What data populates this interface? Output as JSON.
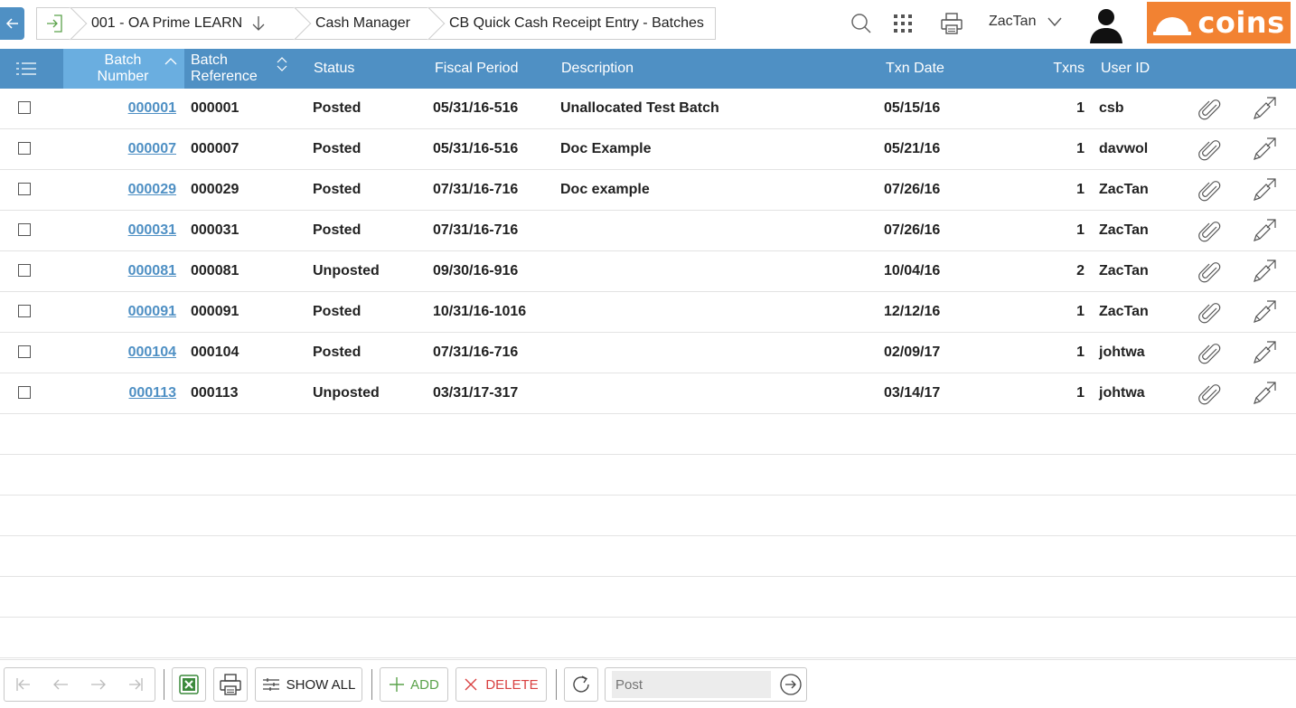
{
  "breadcrumb": {
    "company": "001 - OA Prime LEARN",
    "module": "Cash Manager",
    "page": "CB Quick Cash Receipt Entry - Batches"
  },
  "user": {
    "name": "ZacTan"
  },
  "logo": {
    "text": "coins"
  },
  "colors": {
    "header": "#4f90c4",
    "sorted_header": "#6aaee0",
    "link": "#4f90c4",
    "logo_bg": "#f28232"
  },
  "grid": {
    "columns": {
      "batch_number": "Batch Number",
      "batch_reference": "Batch Reference",
      "status": "Status",
      "fiscal_period": "Fiscal Period",
      "description": "Description",
      "txn_date": "Txn Date",
      "txns": "Txns",
      "user_id": "User ID"
    },
    "rows": [
      {
        "batch_number": "000001",
        "batch_reference": "000001",
        "status": "Posted",
        "fiscal_period": "05/31/16-516",
        "description": "Unallocated Test Batch",
        "txn_date": "05/15/16",
        "txns": "1",
        "user_id": "csb"
      },
      {
        "batch_number": "000007",
        "batch_reference": "000007",
        "status": "Posted",
        "fiscal_period": "05/31/16-516",
        "description": "Doc Example",
        "txn_date": "05/21/16",
        "txns": "1",
        "user_id": "davwol"
      },
      {
        "batch_number": "000029",
        "batch_reference": "000029",
        "status": "Posted",
        "fiscal_period": "07/31/16-716",
        "description": "Doc example",
        "txn_date": "07/26/16",
        "txns": "1",
        "user_id": "ZacTan"
      },
      {
        "batch_number": "000031",
        "batch_reference": "000031",
        "status": "Posted",
        "fiscal_period": "07/31/16-716",
        "description": "",
        "txn_date": "07/26/16",
        "txns": "1",
        "user_id": "ZacTan"
      },
      {
        "batch_number": "000081",
        "batch_reference": "000081",
        "status": "Unposted",
        "fiscal_period": "09/30/16-916",
        "description": "",
        "txn_date": "10/04/16",
        "txns": "2",
        "user_id": "ZacTan"
      },
      {
        "batch_number": "000091",
        "batch_reference": "000091",
        "status": "Posted",
        "fiscal_period": "10/31/16-1016",
        "description": "",
        "txn_date": "12/12/16",
        "txns": "1",
        "user_id": "ZacTan"
      },
      {
        "batch_number": "000104",
        "batch_reference": "000104",
        "status": "Posted",
        "fiscal_period": "07/31/16-716",
        "description": "",
        "txn_date": "02/09/17",
        "txns": "1",
        "user_id": "johtwa"
      },
      {
        "batch_number": "000113",
        "batch_reference": "000113",
        "status": "Unposted",
        "fiscal_period": "03/31/17-317",
        "description": "",
        "txn_date": "03/14/17",
        "txns": "1",
        "user_id": "johtwa"
      }
    ]
  },
  "toolbar": {
    "show_all": "SHOW ALL",
    "add": "ADD",
    "delete": "DELETE",
    "post_placeholder": "Post"
  }
}
